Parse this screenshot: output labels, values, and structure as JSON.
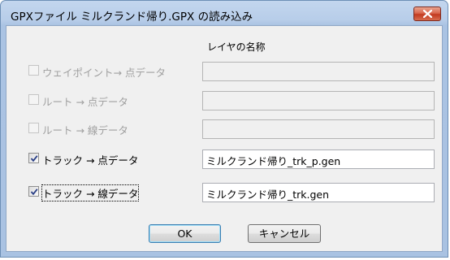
{
  "window": {
    "title": "GPXファイル ミルクランド帰り.GPX の読み込み"
  },
  "column_header": "レイヤの名称",
  "rows": [
    {
      "label": "ウェイポイント→ 点データ",
      "checked": false,
      "enabled": false,
      "layer_name": ""
    },
    {
      "label": "ルート → 点データ",
      "checked": false,
      "enabled": false,
      "layer_name": ""
    },
    {
      "label": "ルート → 線データ",
      "checked": false,
      "enabled": false,
      "layer_name": ""
    },
    {
      "label": "トラック → 点データ",
      "checked": true,
      "enabled": true,
      "layer_name": "ミルクランド帰り_trk_p.gen"
    },
    {
      "label": "トラック → 線データ",
      "checked": true,
      "enabled": true,
      "layer_name": "ミルクランド帰り_trk.gen"
    }
  ],
  "buttons": {
    "ok": "OK",
    "cancel": "キャンセル"
  }
}
